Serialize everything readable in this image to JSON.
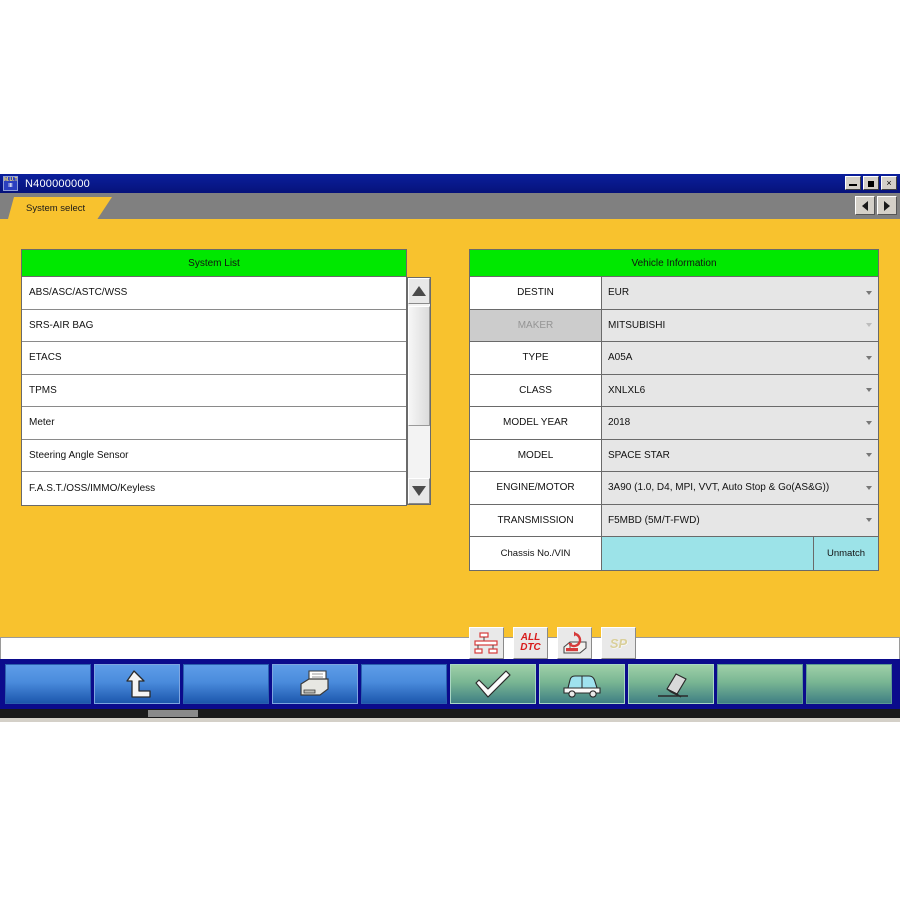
{
  "window": {
    "title": "N400000000",
    "icon_line1": "M.U.T.",
    "icon_line2": "III",
    "minimize_label": "Minimize",
    "maximize_label": "Maximize",
    "close_label": "×"
  },
  "tabs": {
    "active_label": "System select",
    "nav_prev": "prev",
    "nav_next": "next"
  },
  "system_list": {
    "header": "System List",
    "items": [
      {
        "label": "ABS/ASC/ASTC/WSS"
      },
      {
        "label": "SRS-AIR BAG"
      },
      {
        "label": "ETACS"
      },
      {
        "label": "TPMS"
      },
      {
        "label": "Meter"
      },
      {
        "label": "Steering Angle Sensor"
      },
      {
        "label": "F.A.S.T./OSS/IMMO/Keyless"
      }
    ]
  },
  "vehicle_information": {
    "header": "Vehicle Information",
    "rows": [
      {
        "label": "DESTIN",
        "value": "EUR",
        "disabled": false
      },
      {
        "label": "MAKER",
        "value": "MITSUBISHI",
        "disabled": true
      },
      {
        "label": "TYPE",
        "value": "A05A",
        "disabled": false
      },
      {
        "label": "CLASS",
        "value": "XNLXL6",
        "disabled": false
      },
      {
        "label": "MODEL YEAR",
        "value": "2018",
        "disabled": false
      },
      {
        "label": "MODEL",
        "value": "SPACE STAR",
        "disabled": false
      },
      {
        "label": "ENGINE/MOTOR",
        "value": "3A90 (1.0, D4, MPI, VVT, Auto Stop & Go(AS&G))",
        "disabled": false
      },
      {
        "label": "TRANSMISSION",
        "value": "F5MBD (5M/T-FWD)",
        "disabled": false
      }
    ],
    "chassis_label": "Chassis No./VIN",
    "chassis_value": "",
    "unmatch_label": "Unmatch"
  },
  "icon_buttons": [
    {
      "name": "system-tree",
      "label": ""
    },
    {
      "name": "all-dtc",
      "label_line1": "ALL",
      "label_line2": "DTC"
    },
    {
      "name": "scan-tool",
      "label": ""
    },
    {
      "name": "sp",
      "label": "SP",
      "disabled": true
    }
  ],
  "toolbar": {
    "buttons": [
      {
        "name": "blue-empty-1",
        "icon": "none",
        "style": "blue"
      },
      {
        "name": "back",
        "icon": "back-arrow",
        "style": "blue"
      },
      {
        "name": "blue-empty-2",
        "icon": "none",
        "style": "blue"
      },
      {
        "name": "print",
        "icon": "printer",
        "style": "blue"
      },
      {
        "name": "blue-empty-3",
        "icon": "none",
        "style": "blue"
      },
      {
        "name": "confirm",
        "icon": "check",
        "style": "green"
      },
      {
        "name": "vehicle",
        "icon": "car",
        "style": "green"
      },
      {
        "name": "erase",
        "icon": "eraser",
        "style": "green"
      },
      {
        "name": "green-empty-1",
        "icon": "none",
        "style": "green"
      },
      {
        "name": "green-empty-2",
        "icon": "none",
        "style": "green"
      }
    ]
  },
  "colors": {
    "body_yellow": "#f8c22e",
    "panel_header_green": "#00e800",
    "chassis_cyan": "#9ce3e8",
    "titlebar_blue": "#0b1f9c",
    "toolbar_navy": "#0b0b8c"
  }
}
